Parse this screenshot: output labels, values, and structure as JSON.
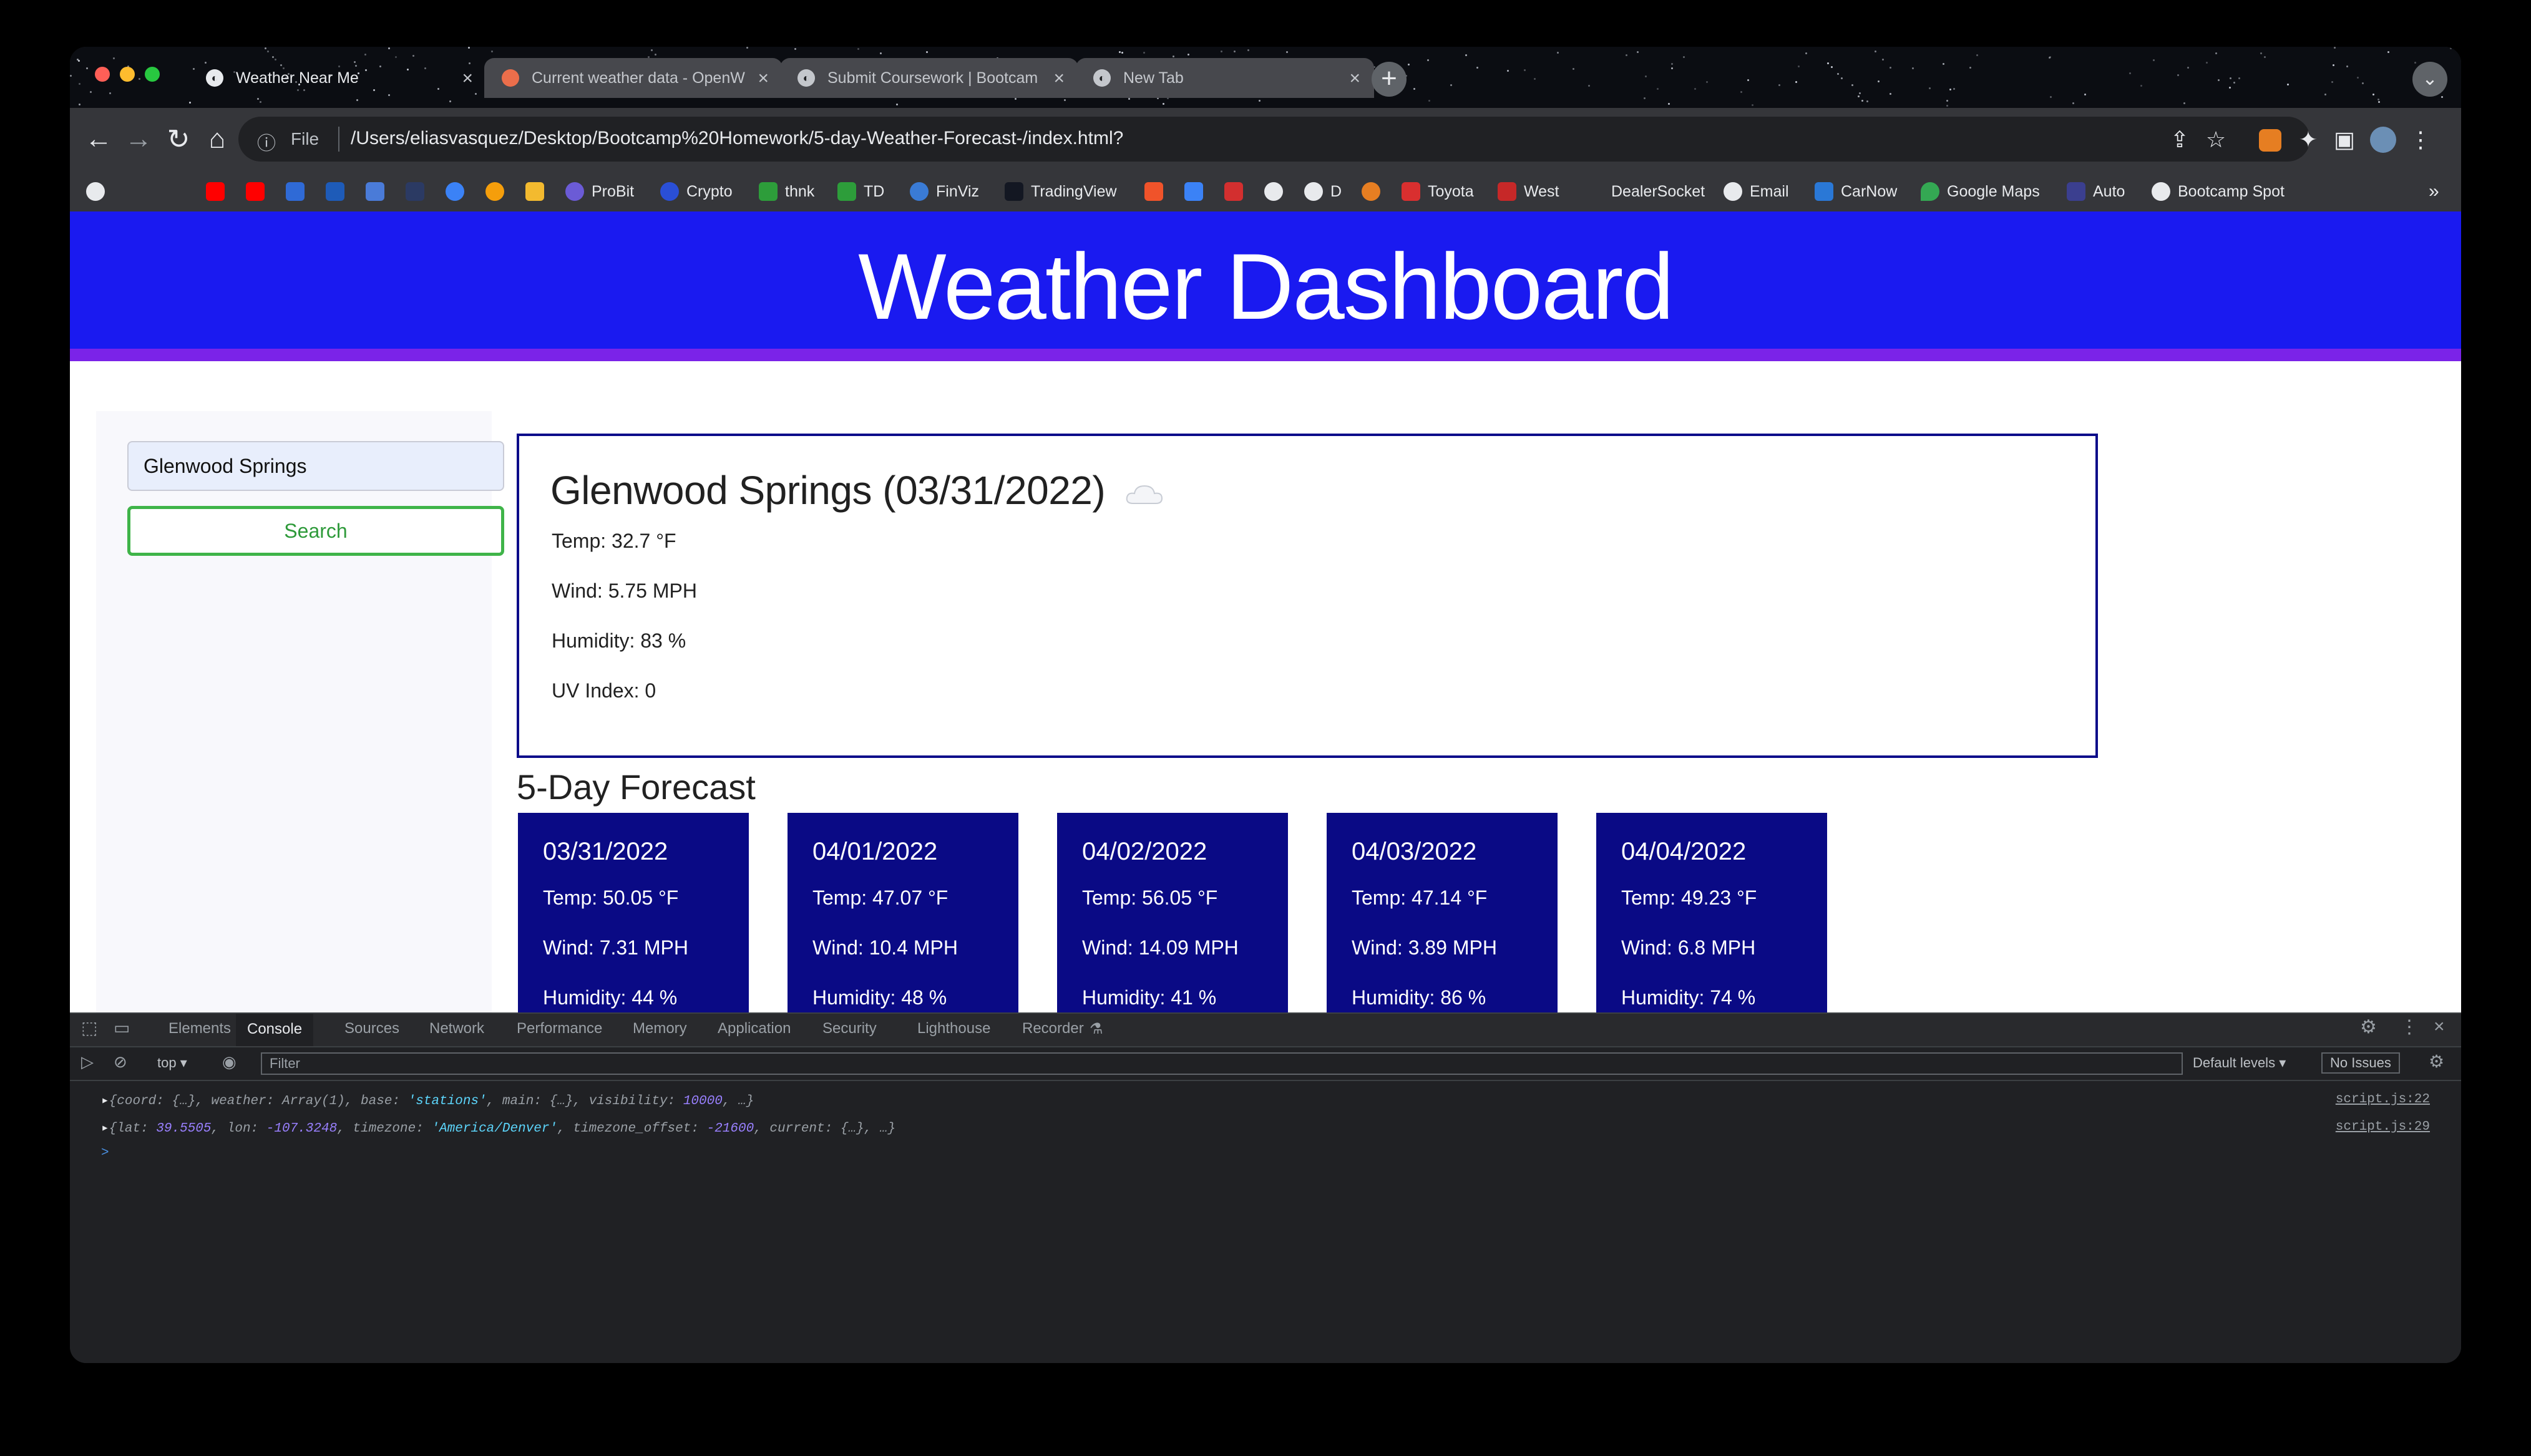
{
  "browser": {
    "tabs": [
      {
        "title": "Weather Near Me",
        "active": true
      },
      {
        "title": "Current weather data - OpenW",
        "active": false
      },
      {
        "title": "Submit Coursework | Bootcam",
        "active": false
      },
      {
        "title": "New Tab",
        "active": false
      }
    ],
    "address": {
      "scheme_label": "File",
      "url": "/Users/eliasvasquez/Desktop/Bootcamp%20Homework/5-day-Weather-Forecast-/index.html?"
    },
    "bookmarks": [
      "ProBit",
      "Crypto",
      "thnk",
      "TD",
      "FinViz",
      "TradingView",
      "D",
      "Toyota",
      "West",
      "DealerSocket",
      "Email",
      "CarNow",
      "Google Maps",
      "Auto",
      "Bootcamp Spot"
    ],
    "bookmarks_overflow": "»"
  },
  "page": {
    "title": "Weather Dashboard",
    "search": {
      "value": "Glenwood Springs",
      "button_label": "Search"
    },
    "current": {
      "heading": "Glenwood Springs (03/31/2022)",
      "icon": "cloud-icon",
      "temp": "Temp: 32.7 °F",
      "wind": "Wind: 5.75 MPH",
      "humidity": "Humidity: 83 %",
      "uv": "UV Index: 0"
    },
    "forecast_title": "5-Day Forecast",
    "forecast": [
      {
        "date": "03/31/2022",
        "temp": "Temp: 50.05 °F",
        "wind": "Wind: 7.31 MPH",
        "humidity": "Humidity: 44 %"
      },
      {
        "date": "04/01/2022",
        "temp": "Temp: 47.07 °F",
        "wind": "Wind: 10.4 MPH",
        "humidity": "Humidity: 48 %"
      },
      {
        "date": "04/02/2022",
        "temp": "Temp: 56.05 °F",
        "wind": "Wind: 14.09 MPH",
        "humidity": "Humidity: 41 %"
      },
      {
        "date": "04/03/2022",
        "temp": "Temp: 47.14 °F",
        "wind": "Wind: 3.89 MPH",
        "humidity": "Humidity: 86 %"
      },
      {
        "date": "04/04/2022",
        "temp": "Temp: 49.23 °F",
        "wind": "Wind: 6.8 MPH",
        "humidity": "Humidity: 74 %"
      }
    ]
  },
  "devtools": {
    "tabs": [
      "Elements",
      "Console",
      "Sources",
      "Network",
      "Performance",
      "Memory",
      "Application",
      "Security",
      "Lighthouse",
      "Recorder"
    ],
    "context": "top",
    "filter_placeholder": "Filter",
    "levels": "Default levels",
    "issues": "No Issues",
    "logs": [
      {
        "key1": "coord",
        "val1": "{…}",
        "key2": "weather",
        "val2": "Array(1)",
        "key3": "base",
        "val3": "'stations'",
        "key4": "main",
        "val4": "{…}",
        "key5": "visibility",
        "val5": "10000",
        "tail": ", …}",
        "source": "script.js:22"
      },
      {
        "key1": "lat",
        "val1": "39.5505",
        "key2": "lon",
        "val2": "-107.3248",
        "key3": "timezone",
        "val3": "'America/Denver'",
        "key4": "timezone_offset",
        "val4": "-21600",
        "key5": "current",
        "val5": "{…}",
        "tail": ", …}",
        "source": "script.js:29"
      }
    ],
    "prompt": ">"
  }
}
